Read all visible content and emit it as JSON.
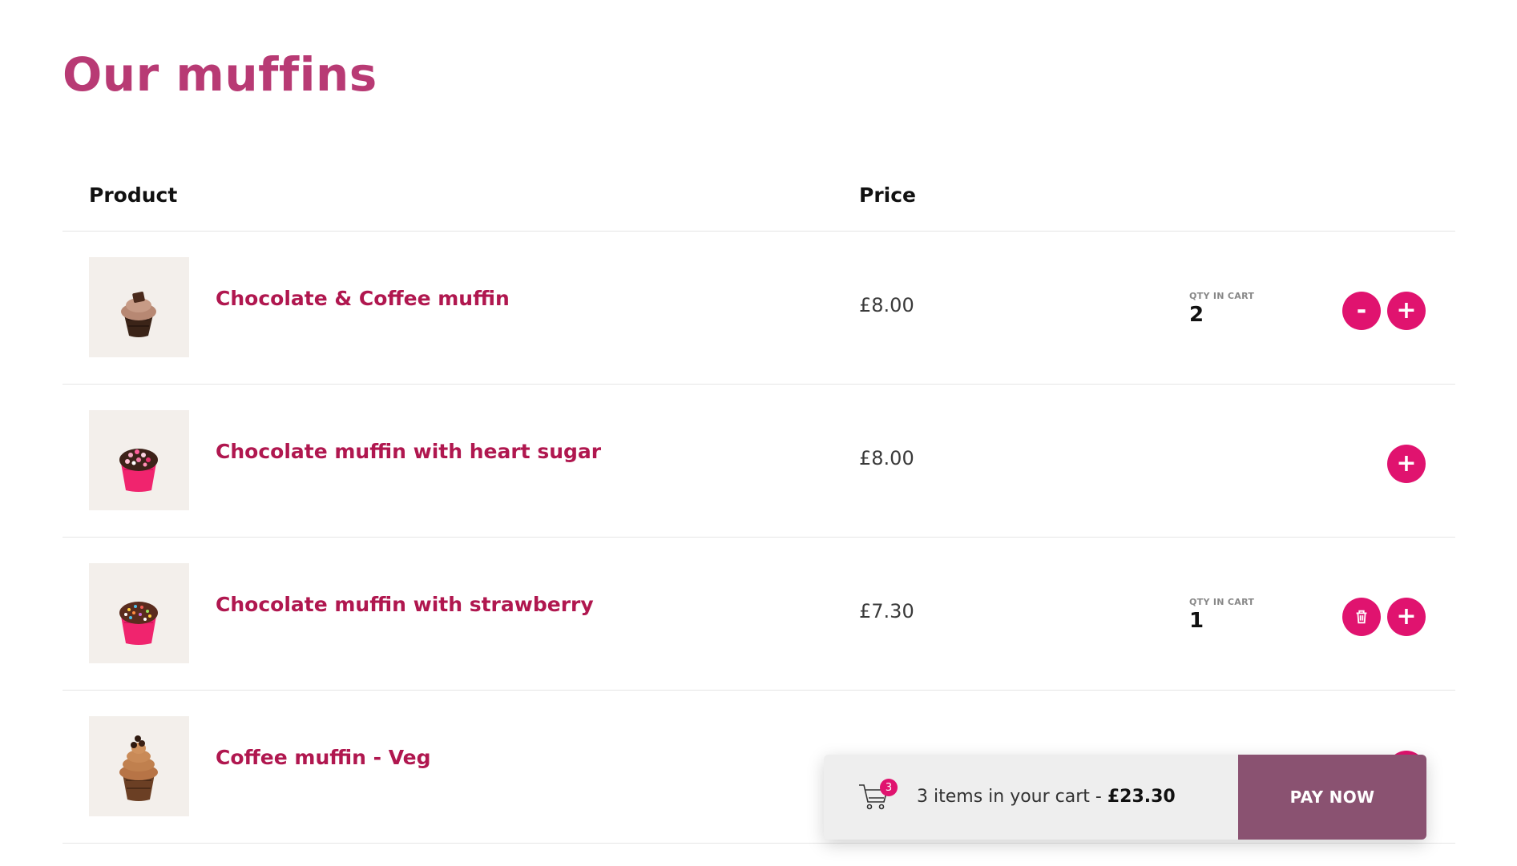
{
  "colors": {
    "title": "#b83a74",
    "product_name": "#b0174f",
    "accent": "#e0136f",
    "pay_button": "#8a5271",
    "cart_bar": "#eeeeee"
  },
  "page": {
    "title": "Our muffins"
  },
  "table": {
    "headers": {
      "product": "Product",
      "price": "Price"
    },
    "qty_label": "QTY IN CART",
    "rows": [
      {
        "name": "Chocolate & Coffee muffin",
        "price": "£8.00",
        "qty": "2",
        "image": "chocolate-coffee-muffin-image",
        "left_action": "minus-icon"
      },
      {
        "name": "Chocolate muffin with heart sugar",
        "price": "£8.00",
        "qty": "",
        "image": "heart-sugar-muffin-image",
        "left_action": ""
      },
      {
        "name": "Chocolate muffin with strawberry",
        "price": "£7.30",
        "qty": "1",
        "image": "strawberry-muffin-image",
        "left_action": "trash-icon"
      },
      {
        "name": "Coffee muffin - Veg",
        "price": "",
        "qty": "",
        "image": "coffee-veg-muffin-image",
        "left_action": ""
      }
    ],
    "plus_label": "+",
    "minus_label": "-"
  },
  "cart": {
    "icon": "cart-icon",
    "badge_count": "3",
    "summary_prefix": "3 items in your cart - ",
    "summary_total": "£23.30",
    "pay_label": "PAY NOW"
  }
}
